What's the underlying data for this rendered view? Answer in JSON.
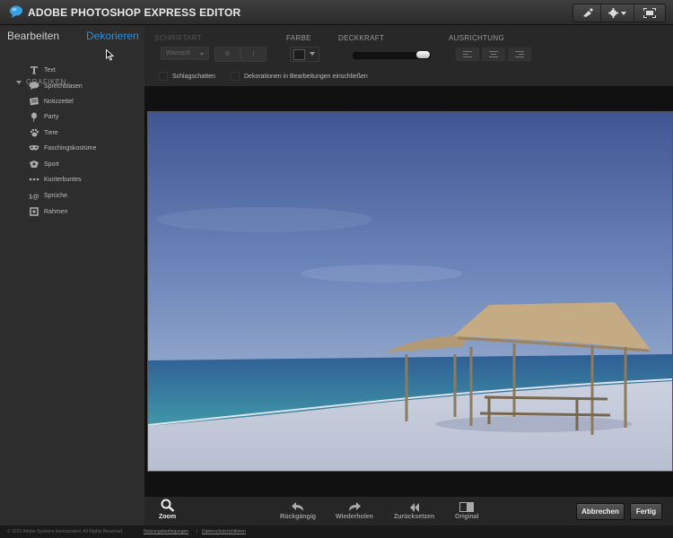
{
  "app": {
    "title": "ADOBE PHOTOSHOP EXPRESS EDITOR"
  },
  "sidebar": {
    "tab_edit": "Bearbeiten",
    "tab_decorate": "Dekorieren",
    "section_title": "GRAFIKEN",
    "items": [
      {
        "label": "Text",
        "icon": "text-icon"
      },
      {
        "label": "Sprechblasen",
        "icon": "speech-bubble-icon"
      },
      {
        "label": "Notizzettel",
        "icon": "note-icon"
      },
      {
        "label": "Party",
        "icon": "balloon-icon"
      },
      {
        "label": "Tiere",
        "icon": "paw-icon"
      },
      {
        "label": "Faschingskostüme",
        "icon": "mask-icon"
      },
      {
        "label": "Sport",
        "icon": "sport-icon"
      },
      {
        "label": "Kunterbuntes",
        "icon": "dots-icon"
      },
      {
        "label": "Sprüche",
        "icon": "quotes-icon"
      },
      {
        "label": "Rahmen",
        "icon": "frame-icon"
      }
    ]
  },
  "toolbar": {
    "font_label": "SCHRIFTART",
    "font_value": "Warnock",
    "bold_label": "B",
    "italic_label": "I",
    "color_label": "FARBE",
    "opacity_label": "DECKKRAFT",
    "opacity_value": 1.0,
    "align_label": "AUSRICHTUNG",
    "shadow_label": "Schlagschatten",
    "include_label": "Dekorationen in Bearbeitungen einschließen"
  },
  "bottom": {
    "zoom": "Zoom",
    "undo": "Rückgängig",
    "redo": "Wiederholen",
    "reset": "Zurücksetzen",
    "original": "Original",
    "cancel": "Abbrechen",
    "done": "Fertig"
  },
  "footer": {
    "copyright": "© 2010 Adobe Systems Incorporated. All Rights Reserved.",
    "terms": "Nutzungsbedingungen",
    "separator": "|",
    "privacy": "Datenschutzrichtlinien"
  },
  "colors": {
    "accent": "#2d8ed8",
    "panel": "#2d2d2d"
  }
}
